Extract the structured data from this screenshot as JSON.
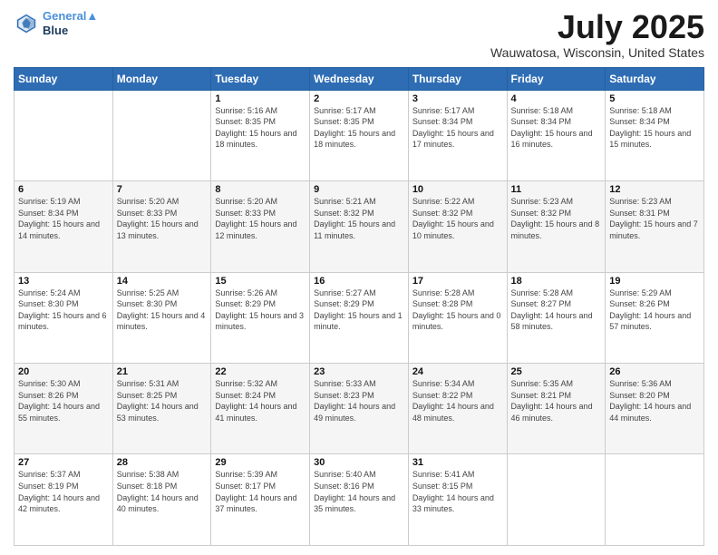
{
  "header": {
    "logo_line1": "General",
    "logo_line2": "Blue",
    "title": "July 2025",
    "subtitle": "Wauwatosa, Wisconsin, United States"
  },
  "weekdays": [
    "Sunday",
    "Monday",
    "Tuesday",
    "Wednesday",
    "Thursday",
    "Friday",
    "Saturday"
  ],
  "weeks": [
    [
      {
        "day": "",
        "sunrise": "",
        "sunset": "",
        "daylight": ""
      },
      {
        "day": "",
        "sunrise": "",
        "sunset": "",
        "daylight": ""
      },
      {
        "day": "1",
        "sunrise": "Sunrise: 5:16 AM",
        "sunset": "Sunset: 8:35 PM",
        "daylight": "Daylight: 15 hours and 18 minutes."
      },
      {
        "day": "2",
        "sunrise": "Sunrise: 5:17 AM",
        "sunset": "Sunset: 8:35 PM",
        "daylight": "Daylight: 15 hours and 18 minutes."
      },
      {
        "day": "3",
        "sunrise": "Sunrise: 5:17 AM",
        "sunset": "Sunset: 8:34 PM",
        "daylight": "Daylight: 15 hours and 17 minutes."
      },
      {
        "day": "4",
        "sunrise": "Sunrise: 5:18 AM",
        "sunset": "Sunset: 8:34 PM",
        "daylight": "Daylight: 15 hours and 16 minutes."
      },
      {
        "day": "5",
        "sunrise": "Sunrise: 5:18 AM",
        "sunset": "Sunset: 8:34 PM",
        "daylight": "Daylight: 15 hours and 15 minutes."
      }
    ],
    [
      {
        "day": "6",
        "sunrise": "Sunrise: 5:19 AM",
        "sunset": "Sunset: 8:34 PM",
        "daylight": "Daylight: 15 hours and 14 minutes."
      },
      {
        "day": "7",
        "sunrise": "Sunrise: 5:20 AM",
        "sunset": "Sunset: 8:33 PM",
        "daylight": "Daylight: 15 hours and 13 minutes."
      },
      {
        "day": "8",
        "sunrise": "Sunrise: 5:20 AM",
        "sunset": "Sunset: 8:33 PM",
        "daylight": "Daylight: 15 hours and 12 minutes."
      },
      {
        "day": "9",
        "sunrise": "Sunrise: 5:21 AM",
        "sunset": "Sunset: 8:32 PM",
        "daylight": "Daylight: 15 hours and 11 minutes."
      },
      {
        "day": "10",
        "sunrise": "Sunrise: 5:22 AM",
        "sunset": "Sunset: 8:32 PM",
        "daylight": "Daylight: 15 hours and 10 minutes."
      },
      {
        "day": "11",
        "sunrise": "Sunrise: 5:23 AM",
        "sunset": "Sunset: 8:32 PM",
        "daylight": "Daylight: 15 hours and 8 minutes."
      },
      {
        "day": "12",
        "sunrise": "Sunrise: 5:23 AM",
        "sunset": "Sunset: 8:31 PM",
        "daylight": "Daylight: 15 hours and 7 minutes."
      }
    ],
    [
      {
        "day": "13",
        "sunrise": "Sunrise: 5:24 AM",
        "sunset": "Sunset: 8:30 PM",
        "daylight": "Daylight: 15 hours and 6 minutes."
      },
      {
        "day": "14",
        "sunrise": "Sunrise: 5:25 AM",
        "sunset": "Sunset: 8:30 PM",
        "daylight": "Daylight: 15 hours and 4 minutes."
      },
      {
        "day": "15",
        "sunrise": "Sunrise: 5:26 AM",
        "sunset": "Sunset: 8:29 PM",
        "daylight": "Daylight: 15 hours and 3 minutes."
      },
      {
        "day": "16",
        "sunrise": "Sunrise: 5:27 AM",
        "sunset": "Sunset: 8:29 PM",
        "daylight": "Daylight: 15 hours and 1 minute."
      },
      {
        "day": "17",
        "sunrise": "Sunrise: 5:28 AM",
        "sunset": "Sunset: 8:28 PM",
        "daylight": "Daylight: 15 hours and 0 minutes."
      },
      {
        "day": "18",
        "sunrise": "Sunrise: 5:28 AM",
        "sunset": "Sunset: 8:27 PM",
        "daylight": "Daylight: 14 hours and 58 minutes."
      },
      {
        "day": "19",
        "sunrise": "Sunrise: 5:29 AM",
        "sunset": "Sunset: 8:26 PM",
        "daylight": "Daylight: 14 hours and 57 minutes."
      }
    ],
    [
      {
        "day": "20",
        "sunrise": "Sunrise: 5:30 AM",
        "sunset": "Sunset: 8:26 PM",
        "daylight": "Daylight: 14 hours and 55 minutes."
      },
      {
        "day": "21",
        "sunrise": "Sunrise: 5:31 AM",
        "sunset": "Sunset: 8:25 PM",
        "daylight": "Daylight: 14 hours and 53 minutes."
      },
      {
        "day": "22",
        "sunrise": "Sunrise: 5:32 AM",
        "sunset": "Sunset: 8:24 PM",
        "daylight": "Daylight: 14 hours and 41 minutes."
      },
      {
        "day": "23",
        "sunrise": "Sunrise: 5:33 AM",
        "sunset": "Sunset: 8:23 PM",
        "daylight": "Daylight: 14 hours and 49 minutes."
      },
      {
        "day": "24",
        "sunrise": "Sunrise: 5:34 AM",
        "sunset": "Sunset: 8:22 PM",
        "daylight": "Daylight: 14 hours and 48 minutes."
      },
      {
        "day": "25",
        "sunrise": "Sunrise: 5:35 AM",
        "sunset": "Sunset: 8:21 PM",
        "daylight": "Daylight: 14 hours and 46 minutes."
      },
      {
        "day": "26",
        "sunrise": "Sunrise: 5:36 AM",
        "sunset": "Sunset: 8:20 PM",
        "daylight": "Daylight: 14 hours and 44 minutes."
      }
    ],
    [
      {
        "day": "27",
        "sunrise": "Sunrise: 5:37 AM",
        "sunset": "Sunset: 8:19 PM",
        "daylight": "Daylight: 14 hours and 42 minutes."
      },
      {
        "day": "28",
        "sunrise": "Sunrise: 5:38 AM",
        "sunset": "Sunset: 8:18 PM",
        "daylight": "Daylight: 14 hours and 40 minutes."
      },
      {
        "day": "29",
        "sunrise": "Sunrise: 5:39 AM",
        "sunset": "Sunset: 8:17 PM",
        "daylight": "Daylight: 14 hours and 37 minutes."
      },
      {
        "day": "30",
        "sunrise": "Sunrise: 5:40 AM",
        "sunset": "Sunset: 8:16 PM",
        "daylight": "Daylight: 14 hours and 35 minutes."
      },
      {
        "day": "31",
        "sunrise": "Sunrise: 5:41 AM",
        "sunset": "Sunset: 8:15 PM",
        "daylight": "Daylight: 14 hours and 33 minutes."
      },
      {
        "day": "",
        "sunrise": "",
        "sunset": "",
        "daylight": ""
      },
      {
        "day": "",
        "sunrise": "",
        "sunset": "",
        "daylight": ""
      }
    ]
  ]
}
